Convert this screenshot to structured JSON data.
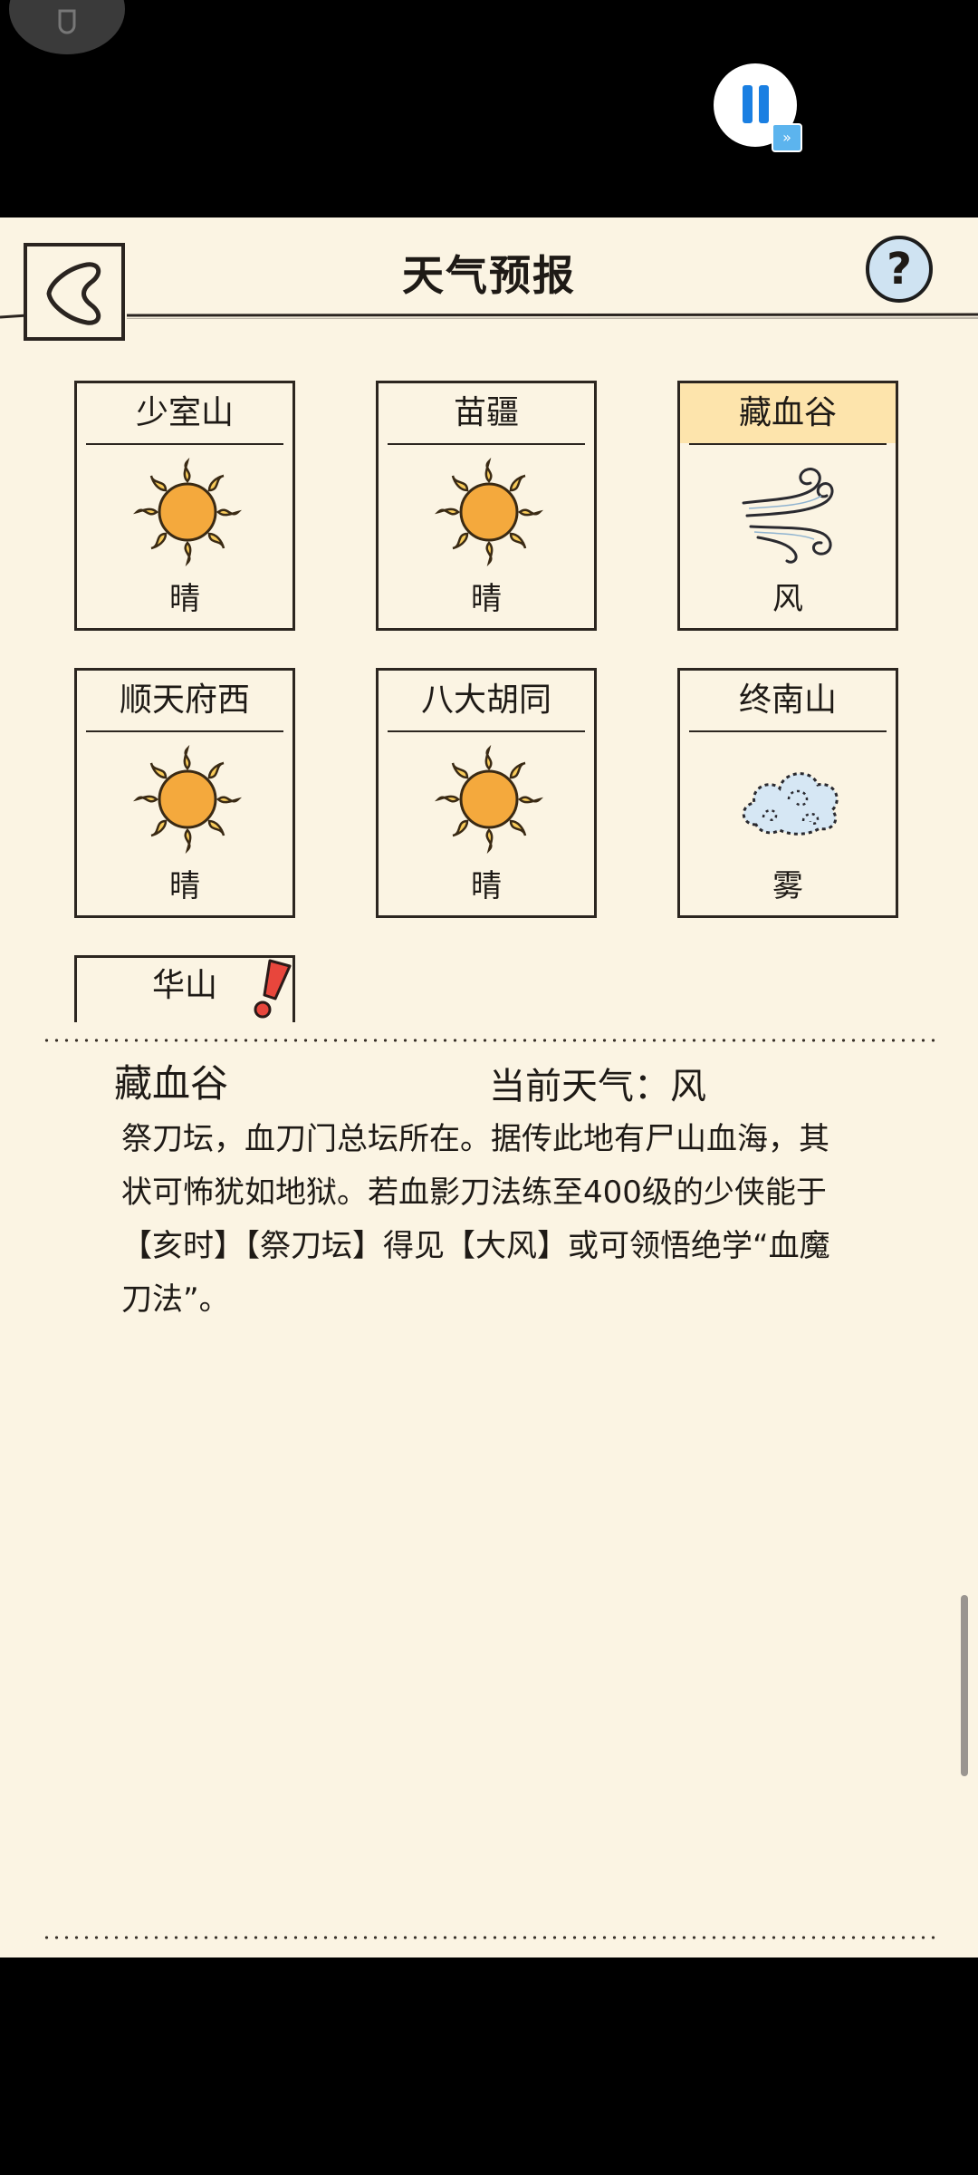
{
  "header": {
    "title": "天气预报"
  },
  "help": {
    "label": "?"
  },
  "locations": [
    {
      "name": "少室山",
      "condition": "晴",
      "icon": "sun-icon"
    },
    {
      "name": "苗疆",
      "condition": "晴",
      "icon": "sun-icon"
    },
    {
      "name": "藏血谷",
      "condition": "风",
      "icon": "wind-icon",
      "selected": true
    },
    {
      "name": "顺天府西",
      "condition": "晴",
      "icon": "sun-icon"
    },
    {
      "name": "八大胡同",
      "condition": "晴",
      "icon": "sun-icon"
    },
    {
      "name": "终南山",
      "condition": "雾",
      "icon": "fog-icon"
    },
    {
      "name": "华山",
      "icon": "alert-icon"
    }
  ],
  "detail": {
    "name": "藏血谷",
    "current_weather": "当前天气：风",
    "description": "祭刀坛，血刀门总坛所在。据传此地有尸山血海，其状可怖犹如地狱。若血影刀法练至400级的少侠能于【亥时】【祭刀坛】得见【大风】或可领悟绝学“血魔刀法”。"
  },
  "colors": {
    "background": "#fbf4e3",
    "selected": "#fde4ac",
    "sun": "#f4a93d",
    "fog": "#d6e7f4"
  }
}
